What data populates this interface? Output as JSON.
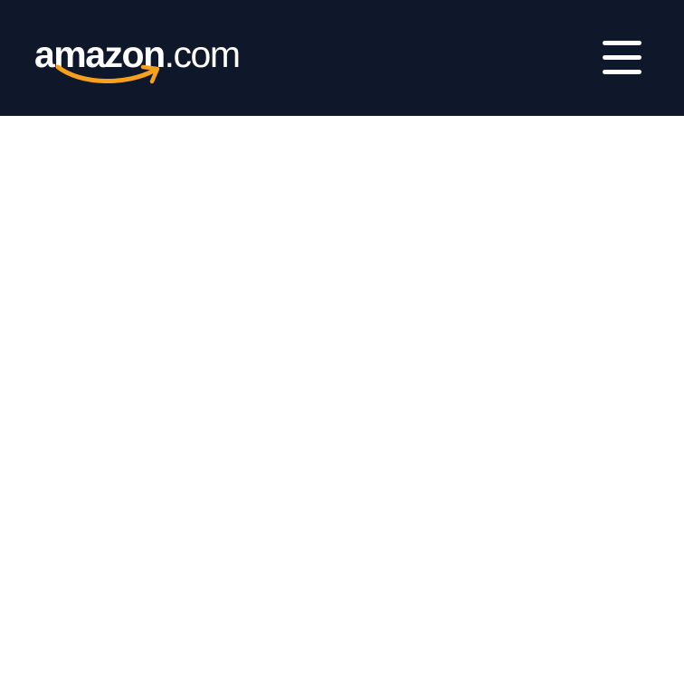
{
  "header": {
    "logo": {
      "text_main": "amazon",
      "text_suffix": ".com",
      "smile_color": "#f7a01c",
      "icon": "amazon-smile-arrow"
    },
    "menu_icon": "hamburger-menu-icon",
    "background_color": "#0f172b"
  },
  "main": {
    "background_color": "#ffffff"
  }
}
